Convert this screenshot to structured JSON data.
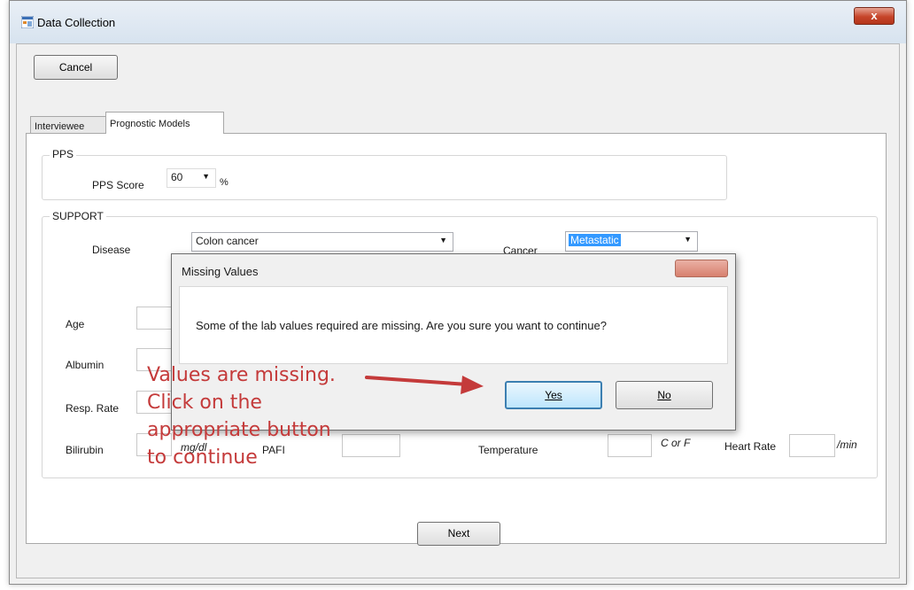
{
  "window": {
    "title": "Data Collection",
    "close_glyph": "x"
  },
  "toolbar": {
    "cancel_label": "Cancel"
  },
  "tabs": [
    {
      "label": "Interviewee",
      "selected": false
    },
    {
      "label": "Prognostic Models",
      "selected": true
    }
  ],
  "pps": {
    "group_title": "PPS",
    "score_label": "PPS Score",
    "score_value": "60",
    "unit": "%"
  },
  "support": {
    "group_title": "SUPPORT",
    "disease_label": "Disease",
    "disease_value": "Colon cancer",
    "cancer_label": "Cancer",
    "cancer_value": "Metastatic",
    "age_label": "Age",
    "albumin_label": "Albumin",
    "resp_rate_label": "Resp. Rate",
    "bilirubin_label": "Bilirubin",
    "bilirubin_unit": "mg/dl",
    "pafi_label": "PAFI",
    "temperature_label": "Temperature",
    "temperature_unit": "C or F",
    "heart_rate_label": "Heart Rate",
    "heart_rate_unit": "/min"
  },
  "footer": {
    "next_label": "Next"
  },
  "dialog": {
    "title": "Missing Values",
    "message": "Some of the lab values required are missing. Are you sure you want to continue?",
    "yes_label": "Yes",
    "no_label": "No"
  },
  "annotation": {
    "lines": [
      "Values are missing.",
      "Click on the",
      "appropriate button",
      "to continue"
    ],
    "color": "#c43a3a"
  },
  "icons": {
    "app": "app-window-icon",
    "dropdown": "chevron-down-icon",
    "arrow": "arrow-right-icon"
  }
}
